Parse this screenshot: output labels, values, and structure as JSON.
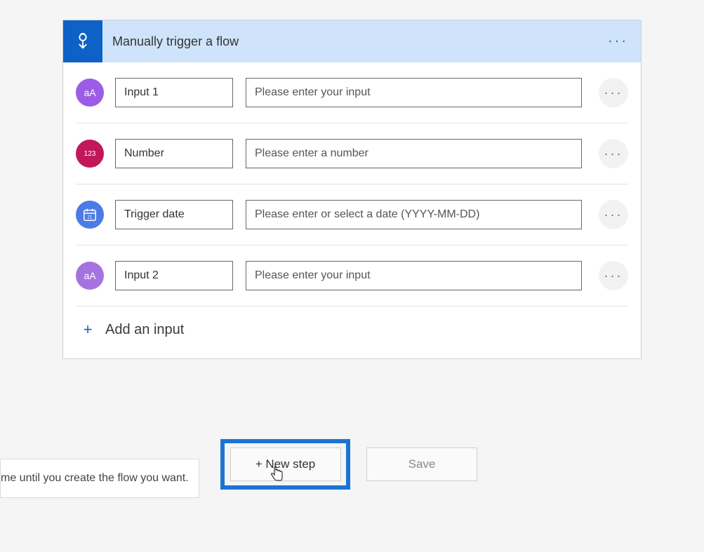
{
  "trigger": {
    "title": "Manually trigger a flow",
    "inputs": [
      {
        "icon_type": "text",
        "icon_label": "aA",
        "name": "Input 1",
        "placeholder": "Please enter your input"
      },
      {
        "icon_type": "number",
        "icon_label": "123",
        "name": "Number",
        "placeholder": "Please enter a number"
      },
      {
        "icon_type": "date",
        "icon_label": "calendar",
        "name": "Trigger date",
        "placeholder": "Please enter or select a date (YYYY-MM-DD)"
      },
      {
        "icon_type": "text2",
        "icon_label": "aA",
        "name": "Input 2",
        "placeholder": "Please enter your input"
      }
    ],
    "add_input_label": "Add an input"
  },
  "actions": {
    "new_step_label": "+ New step",
    "save_label": "Save",
    "hint_text": "me until you create the flow you want."
  }
}
